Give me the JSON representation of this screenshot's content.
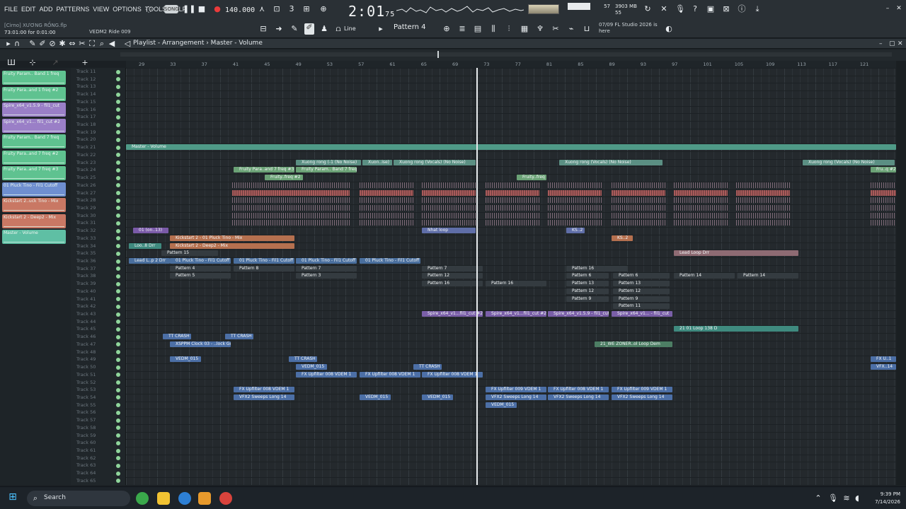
{
  "menu": [
    "FILE",
    "EDIT",
    "ADD",
    "PATTERNS",
    "VIEW",
    "OPTIONS",
    "TOOLS",
    "HELP"
  ],
  "project": {
    "file": "[Cirno] XƯƠNG RỒNG.flp",
    "duration": "73:01:00 for 0:01:00"
  },
  "toolbar": {
    "tempo": "140.000",
    "time_main": "2:01",
    "time_fraction": "75",
    "ride_label": "VEDM2 Ride 009",
    "snap_label": "Line",
    "pattern_label": "Pattern 4",
    "cpu": "57",
    "mem_mb": "3903 MB",
    "mem_pct": "55",
    "hint": "07/09  FL Studio 2026 is here"
  },
  "playlist": {
    "breadcrumb": "Playlist - Arrangement › Master - Volume"
  },
  "ruler": [
    "29",
    "33",
    "37",
    "41",
    "45",
    "49",
    "53",
    "57",
    "61",
    "65",
    "69",
    "73",
    "77",
    "81",
    "85",
    "89",
    "93",
    "97",
    "101",
    "105",
    "109",
    "113",
    "117",
    "121"
  ],
  "channels": [
    {
      "label": "Fruity Param.. Band 1 freq",
      "color": "#5fc290"
    },
    {
      "label": "Fruity Para..and 1 freq #2",
      "color": "#5fc290"
    },
    {
      "label": "Spire_x64_v1.5.9 - fil1_cut",
      "color": "#9a7fc7"
    },
    {
      "label": "Spire_x64_v1... fil1_cut #2",
      "color": "#9a7fc7"
    },
    {
      "label": "Fruity Param.. Band 7 freq",
      "color": "#5fc290"
    },
    {
      "label": "Fruity Para..and 7 freq #2",
      "color": "#5fc290"
    },
    {
      "label": "Fruity Para..and 7 freq #3",
      "color": "#5fc290"
    },
    {
      "label": "01 Pluck Tino - Fil1 Cutoff",
      "color": "#6f8fd0"
    },
    {
      "label": "Kickstart 2..uck Tino - Mix",
      "color": "#c97864"
    },
    {
      "label": "Kickstart 2 - Deep2 - Mix",
      "color": "#c97864"
    },
    {
      "label": "Master - Volume",
      "color": "#5fbfa4"
    }
  ],
  "track_start": 11,
  "track_count": 55,
  "clips": [
    {
      "label": "Master - Volume",
      "track": 21,
      "start": 0,
      "len": 1088,
      "color": "#4f9a87"
    },
    {
      "label": "Xuong rong (-1 (No Noise)",
      "track": 23,
      "start": 240,
      "len": 92,
      "color": "#5b8f83"
    },
    {
      "label": "Xuon..ise)",
      "track": 23,
      "start": 334,
      "len": 42,
      "color": "#5b8f83"
    },
    {
      "label": "Xuong rong (Vocals) (No Noise)",
      "track": 23,
      "start": 378,
      "len": 116,
      "color": "#5b8f83"
    },
    {
      "label": "Xuong rong (Vocals) (No Noise)",
      "track": 23,
      "start": 612,
      "len": 146,
      "color": "#5b8f83"
    },
    {
      "label": "Xuong rong (Vocals) (No Noise)",
      "track": 23,
      "start": 956,
      "len": 130,
      "color": "#5b8f83"
    },
    {
      "label": "Fruity Para..and 7 freq #3",
      "track": 24,
      "start": 152,
      "len": 86,
      "color": "#6ba276"
    },
    {
      "label": "Fruity Param.. Band 7 freq",
      "track": 24,
      "start": 240,
      "len": 86,
      "color": "#6ba276"
    },
    {
      "label": "Fruity..freq #2",
      "track": 25,
      "start": 196,
      "len": 54,
      "color": "#6ba276"
    },
    {
      "label": "Fruity..freq",
      "track": 25,
      "start": 552,
      "len": 42,
      "color": "#6ba276"
    },
    {
      "label": "01 (on..13)",
      "track": 32,
      "start": 10,
      "len": 50,
      "color": "#7a5aa8"
    },
    {
      "label": "Kickstart 2 - 01 Pluck Tino - Mix",
      "track": 33,
      "start": 62,
      "len": 176,
      "color": "#b5704f"
    },
    {
      "label": "Kickstart 2 - Deep2 - Mix",
      "track": 34,
      "start": 62,
      "len": 176,
      "color": "#b5704f"
    },
    {
      "label": "Loo..8 Drr",
      "track": 34,
      "start": 4,
      "len": 46,
      "color": "#3f8a7f"
    },
    {
      "label": "Pattern 15",
      "track": 35,
      "start": 50,
      "len": 80,
      "color": "#343b40"
    },
    {
      "label": "Lead Loop Drr",
      "track": 35,
      "start": 774,
      "len": 176,
      "color": "#8e6b73"
    },
    {
      "label": "Lead L..p 2 Drr",
      "track": 36,
      "start": 4,
      "len": 58,
      "color": "#4a6f9e"
    },
    {
      "label": "01 Pluck Tino - Fil1 Cutoff",
      "track": 36,
      "start": 62,
      "len": 86,
      "color": "#4a6f9e"
    },
    {
      "label": "01 Pluck Tino - Fil1 Cutoff",
      "track": 36,
      "start": 152,
      "len": 86,
      "color": "#4a6f9e"
    },
    {
      "label": "01 Pluck Tino - Fil1 Cutoff",
      "track": 36,
      "start": 240,
      "len": 86,
      "color": "#4a6f9e"
    },
    {
      "label": "01 Pluck Tino - Fil1 Cutoff",
      "track": 36,
      "start": 330,
      "len": 86,
      "color": "#4a6f9e"
    },
    {
      "label": "Spire_x64_v1...fil1_cut #2",
      "track": 43,
      "start": 418,
      "len": 86,
      "color": "#7a5fa8"
    },
    {
      "label": "Spire_x64_v1...fil1_cut #2",
      "track": 43,
      "start": 508,
      "len": 86,
      "color": "#7a5fa8"
    },
    {
      "label": "Spire_x64_v1.5.9 - fil1_cut",
      "track": 43,
      "start": 596,
      "len": 86,
      "color": "#7a5fa8"
    },
    {
      "label": "Spire_x64_v1... - fil1_cut",
      "track": 43,
      "start": 686,
      "len": 86,
      "color": "#7a5fa8"
    },
    {
      "label": "21 01 Loop 138 D",
      "track": 45,
      "start": 774,
      "len": 176,
      "color": "#3f8a7f"
    },
    {
      "label": "TT CRASH",
      "track": 46,
      "start": 52,
      "len": 40,
      "color": "#4c6fa6"
    },
    {
      "label": "TT CRASH",
      "track": 46,
      "start": 140,
      "len": 40,
      "color": "#4c6fa6"
    },
    {
      "label": "XSPPM Clock 03 - ..lock Goes Crazy",
      "track": 47,
      "start": 62,
      "len": 86,
      "color": "#4c6fa6"
    },
    {
      "label": "21_WE ZONER..ol Loop Dem",
      "track": 47,
      "start": 662,
      "len": 110,
      "color": "#4d7e64"
    },
    {
      "label": "VEDM_015",
      "track": 49,
      "start": 62,
      "len": 44,
      "color": "#4c6fa6"
    },
    {
      "label": "TT CRASH",
      "track": 49,
      "start": 230,
      "len": 40,
      "color": "#4c6fa6"
    },
    {
      "label": "VEDM_015",
      "track": 50,
      "start": 240,
      "len": 44,
      "color": "#4c6fa6"
    },
    {
      "label": "TT CRASH",
      "track": 50,
      "start": 406,
      "len": 40,
      "color": "#4c6fa6"
    },
    {
      "label": "FX Upfilter 008 VDEM 1",
      "track": 51,
      "start": 240,
      "len": 86,
      "color": "#4c6fa6"
    },
    {
      "label": "FX Upfilter 008 VDEM 1",
      "track": 51,
      "start": 330,
      "len": 86,
      "color": "#4c6fa6"
    },
    {
      "label": "FX Upfilter 008 VDEM 1",
      "track": 51,
      "start": 418,
      "len": 86,
      "color": "#4c6fa6"
    },
    {
      "label": "FX Upfilter 008 VDEM 1",
      "track": 53,
      "start": 152,
      "len": 86,
      "color": "#4c6fa6"
    },
    {
      "label": "FX Upfilter 009 VDEM 1",
      "track": 53,
      "start": 508,
      "len": 86,
      "color": "#4c6fa6"
    },
    {
      "label": "FX Upfilter 008 VDEM 1",
      "track": 53,
      "start": 596,
      "len": 86,
      "color": "#4c6fa6"
    },
    {
      "label": "FX Upfilter 009 VDEM 1",
      "track": 53,
      "start": 686,
      "len": 86,
      "color": "#4c6fa6"
    },
    {
      "label": "VFX2 Sweeps Long 14",
      "track": 54,
      "start": 152,
      "len": 86,
      "color": "#4c6fa6"
    },
    {
      "label": "VEDM_015",
      "track": 54,
      "start": 330,
      "len": 44,
      "color": "#4c6fa6"
    },
    {
      "label": "VEDM_015",
      "track": 54,
      "start": 418,
      "len": 44,
      "color": "#4c6fa6"
    },
    {
      "label": "VFX2 Sweeps Long 14",
      "track": 54,
      "start": 508,
      "len": 86,
      "color": "#4c6fa6"
    },
    {
      "label": "VFX2 Sweeps Long 14",
      "track": 54,
      "start": 596,
      "len": 86,
      "color": "#4c6fa6"
    },
    {
      "label": "VFX2 Sweeps Long 14",
      "track": 54,
      "start": 686,
      "len": 86,
      "color": "#4c6fa6"
    },
    {
      "label": "VEDM_015",
      "track": 55,
      "start": 508,
      "len": 44,
      "color": "#4c6fa6"
    },
    {
      "label": "Pattern 4",
      "track": 37,
      "start": 62,
      "len": 86,
      "color": "#343b40"
    },
    {
      "label": "Pattern 8",
      "track": 37,
      "start": 152,
      "len": 86,
      "color": "#343b40"
    },
    {
      "label": "Pattern 7",
      "track": 37,
      "start": 240,
      "len": 86,
      "color": "#343b40"
    },
    {
      "label": "Pattern 7",
      "track": 37,
      "start": 418,
      "len": 86,
      "color": "#343b40"
    },
    {
      "label": "Pattern 16",
      "track": 37,
      "start": 622,
      "len": 86,
      "color": "#343b40"
    },
    {
      "label": "Pattern 5",
      "track": 38,
      "start": 62,
      "len": 86,
      "color": "#343b40"
    },
    {
      "label": "Pattern 3",
      "track": 38,
      "start": 240,
      "len": 86,
      "color": "#343b40"
    },
    {
      "label": "Pattern 12",
      "track": 38,
      "start": 418,
      "len": 86,
      "color": "#343b40"
    },
    {
      "label": "Pattern 6",
      "track": 38,
      "start": 622,
      "len": 60,
      "color": "#343b40"
    },
    {
      "label": "Pattern 6",
      "track": 38,
      "start": 688,
      "len": 80,
      "color": "#343b40"
    },
    {
      "label": "Pattern 14",
      "track": 38,
      "start": 774,
      "len": 86,
      "color": "#343b40"
    },
    {
      "label": "Pattern 14",
      "track": 38,
      "start": 864,
      "len": 86,
      "color": "#343b40"
    },
    {
      "label": "Pattern 16",
      "track": 39,
      "start": 418,
      "len": 86,
      "color": "#343b40"
    },
    {
      "label": "Pattern 16",
      "track": 39,
      "start": 508,
      "len": 86,
      "color": "#343b40"
    },
    {
      "label": "Pattern 13",
      "track": 39,
      "start": 622,
      "len": 60,
      "color": "#343b40"
    },
    {
      "label": "Pattern 13",
      "track": 39,
      "start": 688,
      "len": 80,
      "color": "#343b40"
    },
    {
      "label": "Pattern 12",
      "track": 40,
      "start": 622,
      "len": 60,
      "color": "#343b40"
    },
    {
      "label": "Pattern 12",
      "track": 40,
      "start": 688,
      "len": 80,
      "color": "#343b40"
    },
    {
      "label": "Pattern 9",
      "track": 41,
      "start": 622,
      "len": 60,
      "color": "#343b40"
    },
    {
      "label": "Pattern 9",
      "track": 41,
      "start": 688,
      "len": 80,
      "color": "#343b40"
    },
    {
      "label": "Pattern 11",
      "track": 42,
      "start": 688,
      "len": 80,
      "color": "#343b40"
    },
    {
      "label": "Nhat loop",
      "track": 32,
      "start": 418,
      "len": 76,
      "color": "#5f6ea8"
    },
    {
      "label": "KS..2",
      "track": 32,
      "start": 622,
      "len": 26,
      "color": "#5f6ea8"
    },
    {
      "label": "KS..2",
      "track": 33,
      "start": 686,
      "len": 30,
      "color": "#b5704f"
    },
    {
      "label": "FX U..1",
      "track": 49,
      "start": 1052,
      "len": 36,
      "color": "#4c6fa6"
    },
    {
      "label": "VFX..14",
      "track": 50,
      "start": 1052,
      "len": 36,
      "color": "#4c6fa6"
    },
    {
      "label": "Fru..q #2",
      "track": 24,
      "start": 1052,
      "len": 36,
      "color": "#6ba276"
    }
  ],
  "taskbar": {
    "search": "Search",
    "time": "9:39 PM",
    "date": "7/14/2026"
  }
}
